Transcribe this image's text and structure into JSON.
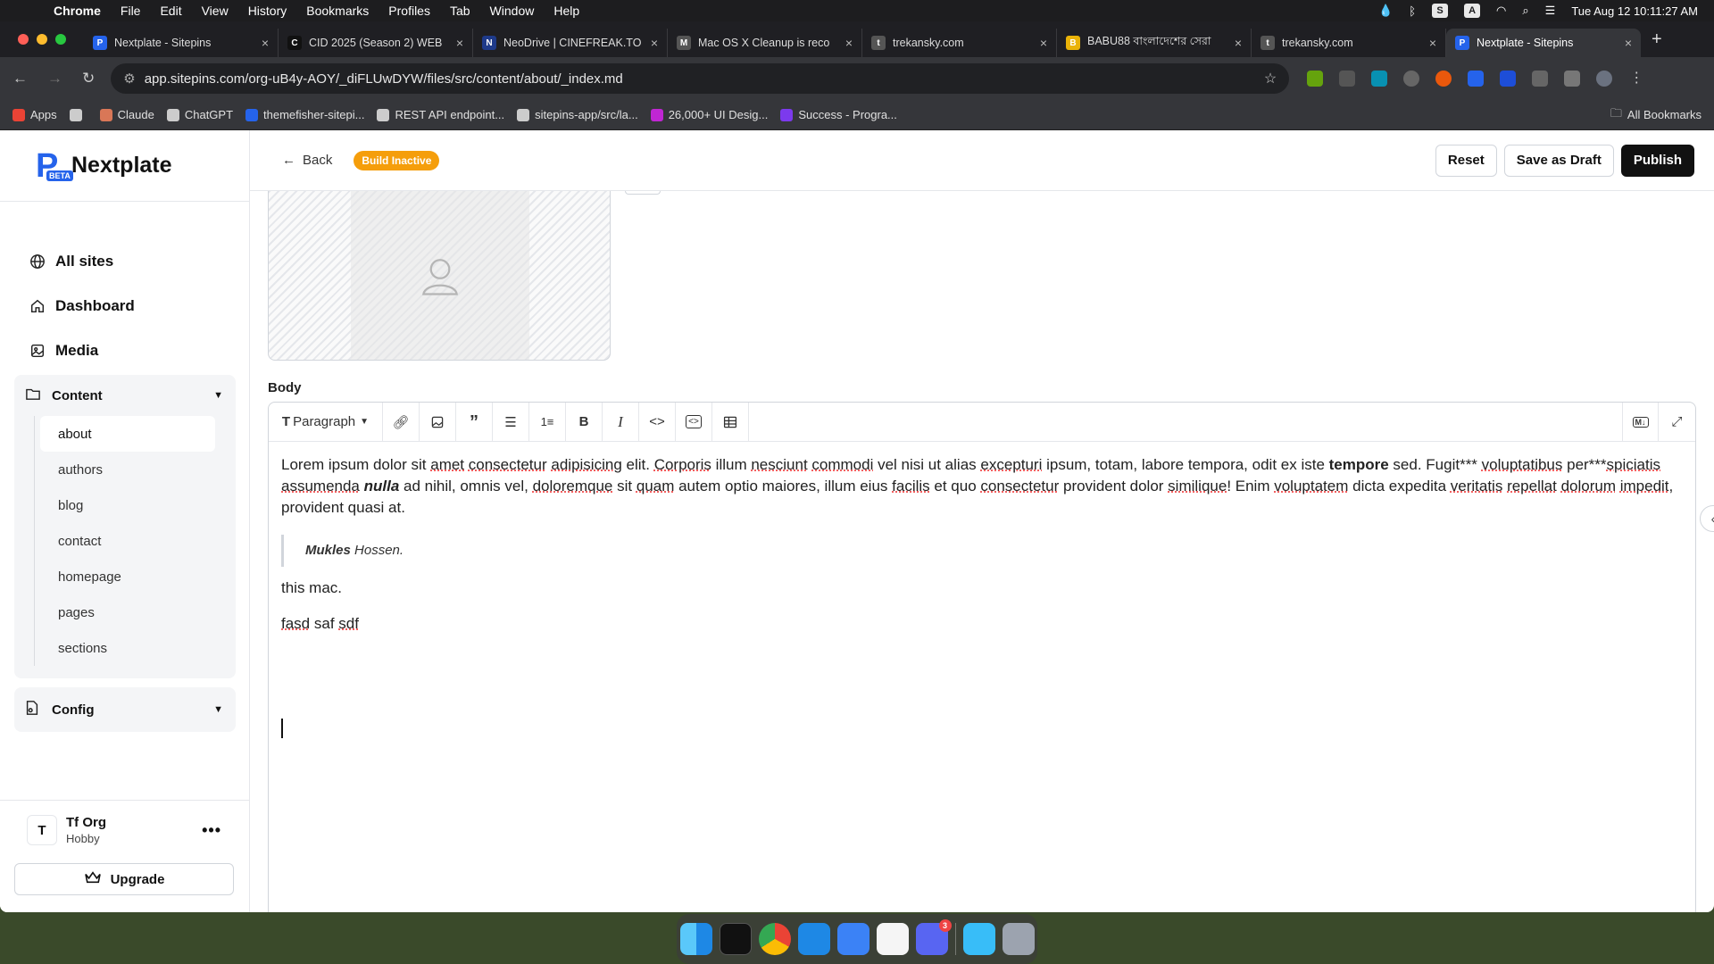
{
  "menubar": {
    "app": "Chrome",
    "items": [
      "File",
      "Edit",
      "View",
      "History",
      "Bookmarks",
      "Profiles",
      "Tab",
      "Window",
      "Help"
    ],
    "status_s": "S",
    "status_a": "A",
    "clock": "Tue Aug 12  10:11:27 AM"
  },
  "tabs": [
    {
      "title": "Nextplate - Sitepins",
      "fav": "P",
      "color": "#2563eb"
    },
    {
      "title": "CID 2025 (Season 2) WEB",
      "fav": "C",
      "color": "#111111"
    },
    {
      "title": "NeoDrive | CINEFREAK.TO",
      "fav": "N",
      "color": "#1e3a8a"
    },
    {
      "title": "Mac OS X Cleanup is reco",
      "fav": "M",
      "color": "#555555"
    },
    {
      "title": "trekansky.com",
      "fav": "t",
      "color": "#555555"
    },
    {
      "title": "BABU88 বাংলাদেশের সেরা",
      "fav": "B",
      "color": "#eab308"
    },
    {
      "title": "trekansky.com",
      "fav": "t",
      "color": "#555555"
    },
    {
      "title": "Nextplate - Sitepins",
      "fav": "P",
      "color": "#2563eb",
      "active": true
    }
  ],
  "omnibox": {
    "url": "app.sitepins.com/org-uB4y-AOY/_diFLUwDYW/files/src/content/about/_index.md"
  },
  "bookmarks": [
    {
      "label": "Apps",
      "color": "#ea4335"
    },
    {
      "label": "",
      "color": "#cccccc"
    },
    {
      "label": "Claude",
      "color": "#d97757"
    },
    {
      "label": "ChatGPT",
      "color": "#cccccc"
    },
    {
      "label": "themefisher-sitepi...",
      "color": "#2563eb"
    },
    {
      "label": "REST API endpoint...",
      "color": "#cccccc"
    },
    {
      "label": "sitepins-app/src/la...",
      "color": "#cccccc"
    },
    {
      "label": "26,000+ UI Desig...",
      "color": "#c026d3"
    },
    {
      "label": "Success - Progra...",
      "color": "#7c3aed"
    }
  ],
  "all_bookmarks": "All Bookmarks",
  "brand": {
    "name": "Nextplate",
    "beta": "BETA"
  },
  "nav": [
    {
      "label": "All sites",
      "icon": "globe-icon",
      "glyph": "🌐"
    },
    {
      "label": "Dashboard",
      "icon": "home-icon",
      "glyph": "⌂"
    },
    {
      "label": "Media",
      "icon": "image-icon",
      "glyph": "▣"
    }
  ],
  "content_section": {
    "label": "Content",
    "items": [
      "about",
      "authors",
      "blog",
      "contact",
      "homepage",
      "pages",
      "sections"
    ],
    "active": "about"
  },
  "config_section": {
    "label": "Config"
  },
  "org": {
    "initial": "T",
    "name": "Tf Org",
    "plan": "Hobby",
    "upgrade": "Upgrade"
  },
  "topbar": {
    "back": "Back",
    "badge": "Build Inactive",
    "reset": "Reset",
    "save_draft": "Save as  Draft",
    "publish": "Publish"
  },
  "body_label": "Body",
  "editor_toolbar": {
    "paragraph": "Paragraph"
  },
  "editor": {
    "p1_a": "Lorem ipsum dolor sit ",
    "p1_amet": "amet",
    "p1_b": " ",
    "p1_consectetur": "consectetur",
    "p1_c": " ",
    "p1_adipisicing": "adipisicing",
    "p1_d": " elit. ",
    "p1_corporis": "Corporis",
    "p1_e": " illum ",
    "p1_nesciunt": "nesciunt",
    "p1_f": " ",
    "p1_commodi": "commodi",
    "p1_g": " vel nisi ut alias ",
    "p1_excepturi": "excepturi",
    "p1_h": " ipsum, totam, labore tempora, odit ex iste ",
    "p1_tempore": "tempore",
    "p1_i": " sed. Fugit*** ",
    "p1_voluptatibus": "voluptatibus",
    "p1_j": " per***",
    "p1_spiciatis": "spiciatis",
    "p1_k": " ",
    "p1_assumenda": "assumenda",
    "p1_l": " ",
    "p1_nulla": "nulla",
    "p1_m": " ad nihil, omnis vel, ",
    "p1_doloremque": "doloremque",
    "p1_n": " sit ",
    "p1_quam": "quam",
    "p1_o": " autem optio maiores, illum eius ",
    "p1_facilis": "facilis",
    "p1_p": " et quo ",
    "p1_consectetur2": "consectetur",
    "p1_q": " provident dolor ",
    "p1_similique": "similique",
    "p1_r": "! Enim ",
    "p1_voluptatem": "voluptatem",
    "p1_s": " dicta expedita ",
    "p1_veritatis": "veritatis",
    "p1_t": " ",
    "p1_repellat": "repellat",
    "p1_u": " ",
    "p1_dolorum": "dolorum",
    "p1_v": " ",
    "p1_impedit": "impedit",
    "p1_w": ", provident quasi at.",
    "quote_bold": "Mukles",
    "quote_rest": " Hossen.",
    "line1": "this mac.",
    "line2_a": "fasd",
    "line2_b": " saf ",
    "line2_c": "sdf"
  },
  "dock": {
    "apps": [
      "finder-icon",
      "terminal-icon",
      "chrome-icon",
      "vscode-icon",
      "mail-icon",
      "mongodb-icon",
      "discord-icon",
      "downloads-icon",
      "trash-icon"
    ],
    "discord_badge": "3"
  }
}
